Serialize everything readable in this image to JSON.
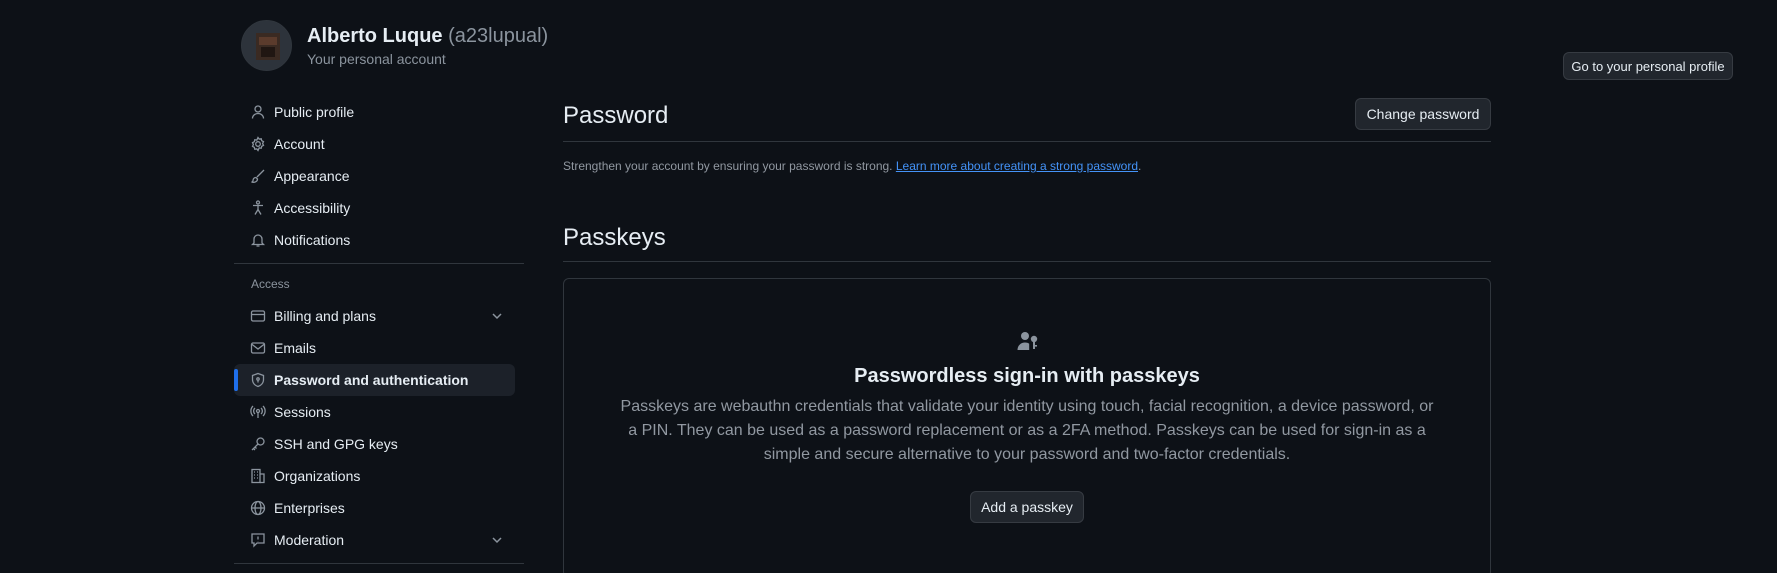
{
  "header": {
    "name": "Alberto Luque",
    "handle": "(a23lupual)",
    "subtitle": "Your personal account",
    "profile_button": "Go to your personal profile"
  },
  "sidebar": {
    "items": [
      {
        "label": "Public profile",
        "icon": "person-icon"
      },
      {
        "label": "Account",
        "icon": "gear-icon"
      },
      {
        "label": "Appearance",
        "icon": "paintbrush-icon"
      },
      {
        "label": "Accessibility",
        "icon": "accessibility-icon"
      },
      {
        "label": "Notifications",
        "icon": "bell-icon"
      }
    ],
    "access_label": "Access",
    "access_items": [
      {
        "label": "Billing and plans",
        "icon": "credit-card-icon",
        "expandable": true
      },
      {
        "label": "Emails",
        "icon": "mail-icon"
      },
      {
        "label": "Password and authentication",
        "icon": "shield-lock-icon",
        "active": true
      },
      {
        "label": "Sessions",
        "icon": "broadcast-icon"
      },
      {
        "label": "SSH and GPG keys",
        "icon": "key-icon"
      },
      {
        "label": "Organizations",
        "icon": "organization-icon"
      },
      {
        "label": "Enterprises",
        "icon": "globe-icon"
      },
      {
        "label": "Moderation",
        "icon": "report-icon",
        "expandable": true
      }
    ]
  },
  "password": {
    "title": "Password",
    "change_button": "Change password",
    "description": "Strengthen your account by ensuring your password is strong.",
    "link_text": "Learn more about creating a strong password",
    "period": "."
  },
  "passkeys": {
    "title": "Passkeys",
    "blank_title": "Passwordless sign-in with passkeys",
    "blank_text": "Passkeys are webauthn credentials that validate your identity using touch, facial recognition, a device password, or a PIN. They can be used as a password replacement or as a 2FA method. Passkeys can be used for sign-in as a simple and secure alternative to your password and two-factor credentials.",
    "add_button": "Add a passkey",
    "icon": "passkey-icon"
  },
  "colors": {
    "background": "#0d1117",
    "accent": "#1f6feb",
    "link": "#4493f8",
    "border": "#30363d"
  }
}
